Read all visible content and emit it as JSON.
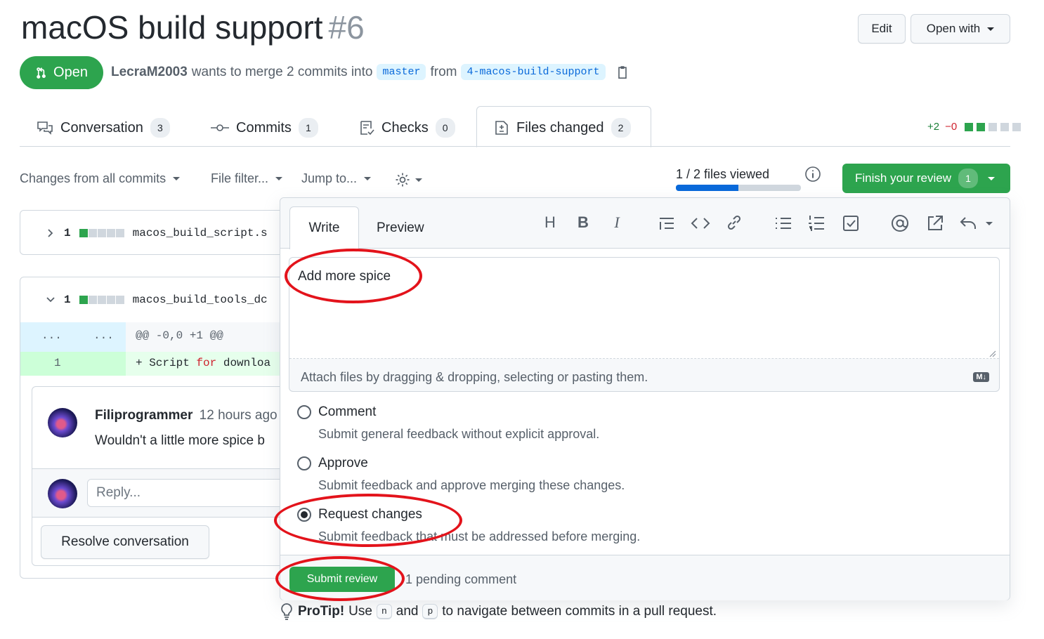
{
  "pr": {
    "title": "macOS build support",
    "number": "#6",
    "state": "Open",
    "author": "LecraM2003",
    "meta_text": "wants to merge 2 commits into",
    "base_branch": "master",
    "from_text": "from",
    "head_branch": "4-macos-build-support"
  },
  "header_buttons": {
    "edit": "Edit",
    "open_with": "Open with"
  },
  "tabs": [
    {
      "label": "Conversation",
      "count": "3",
      "icon": "comment-discussion-icon"
    },
    {
      "label": "Commits",
      "count": "1",
      "icon": "git-commit-icon"
    },
    {
      "label": "Checks",
      "count": "0",
      "icon": "checklist-icon"
    },
    {
      "label": "Files changed",
      "count": "2",
      "icon": "file-diff-icon"
    }
  ],
  "diffstat": {
    "additions": "+2",
    "deletions": "−0",
    "colors": {
      "add": "#2da44e",
      "del": "#cf222e",
      "neutral": "#d0d7de"
    }
  },
  "toolbar": {
    "changes_from": "Changes from all commits",
    "file_filter": "File filter...",
    "jump_to": "Jump to...",
    "files_viewed": "1 / 2 files viewed",
    "files_viewed_fraction": 0.5,
    "finish_review": "Finish your review",
    "finish_review_count": "1"
  },
  "files": [
    {
      "changes": "1",
      "name": "macos_build_script.s"
    },
    {
      "changes": "1",
      "name": "macos_build_tools_dc",
      "hunk": "@@ -0,0 +1 @@",
      "hunk_left": "...",
      "hunk_right": "...",
      "line_no": "1",
      "line_prefix": "+ Script ",
      "line_keyword": "for",
      "line_rest": " downloa"
    }
  ],
  "comment": {
    "author": "Filiprogrammer",
    "time": "12 hours ago",
    "body": "Wouldn't a little more spice b",
    "reply_placeholder": "Reply...",
    "resolve": "Resolve conversation"
  },
  "review": {
    "tab_write": "Write",
    "tab_preview": "Preview",
    "tools": [
      "H",
      "B",
      "I"
    ],
    "text": "Add more spice",
    "attach_hint": "Attach files by dragging & dropping, selecting or pasting them.",
    "md_badge": "M↓",
    "options": [
      {
        "label": "Comment",
        "desc": "Submit general feedback without explicit approval.",
        "checked": false
      },
      {
        "label": "Approve",
        "desc": "Submit feedback and approve merging these changes.",
        "checked": false
      },
      {
        "label": "Request changes",
        "desc": "Submit feedback that must be addressed before merging.",
        "checked": true
      }
    ],
    "submit": "Submit review",
    "pending": "1 pending comment"
  },
  "protip": {
    "bold": "ProTip!",
    "use": "Use",
    "key1": "n",
    "and": "and",
    "key2": "p",
    "rest": "to navigate between commits in a pull request."
  },
  "colors": {
    "green": "#2da44e",
    "blue_link": "#0969da",
    "annotation_red": "#e3131b"
  }
}
